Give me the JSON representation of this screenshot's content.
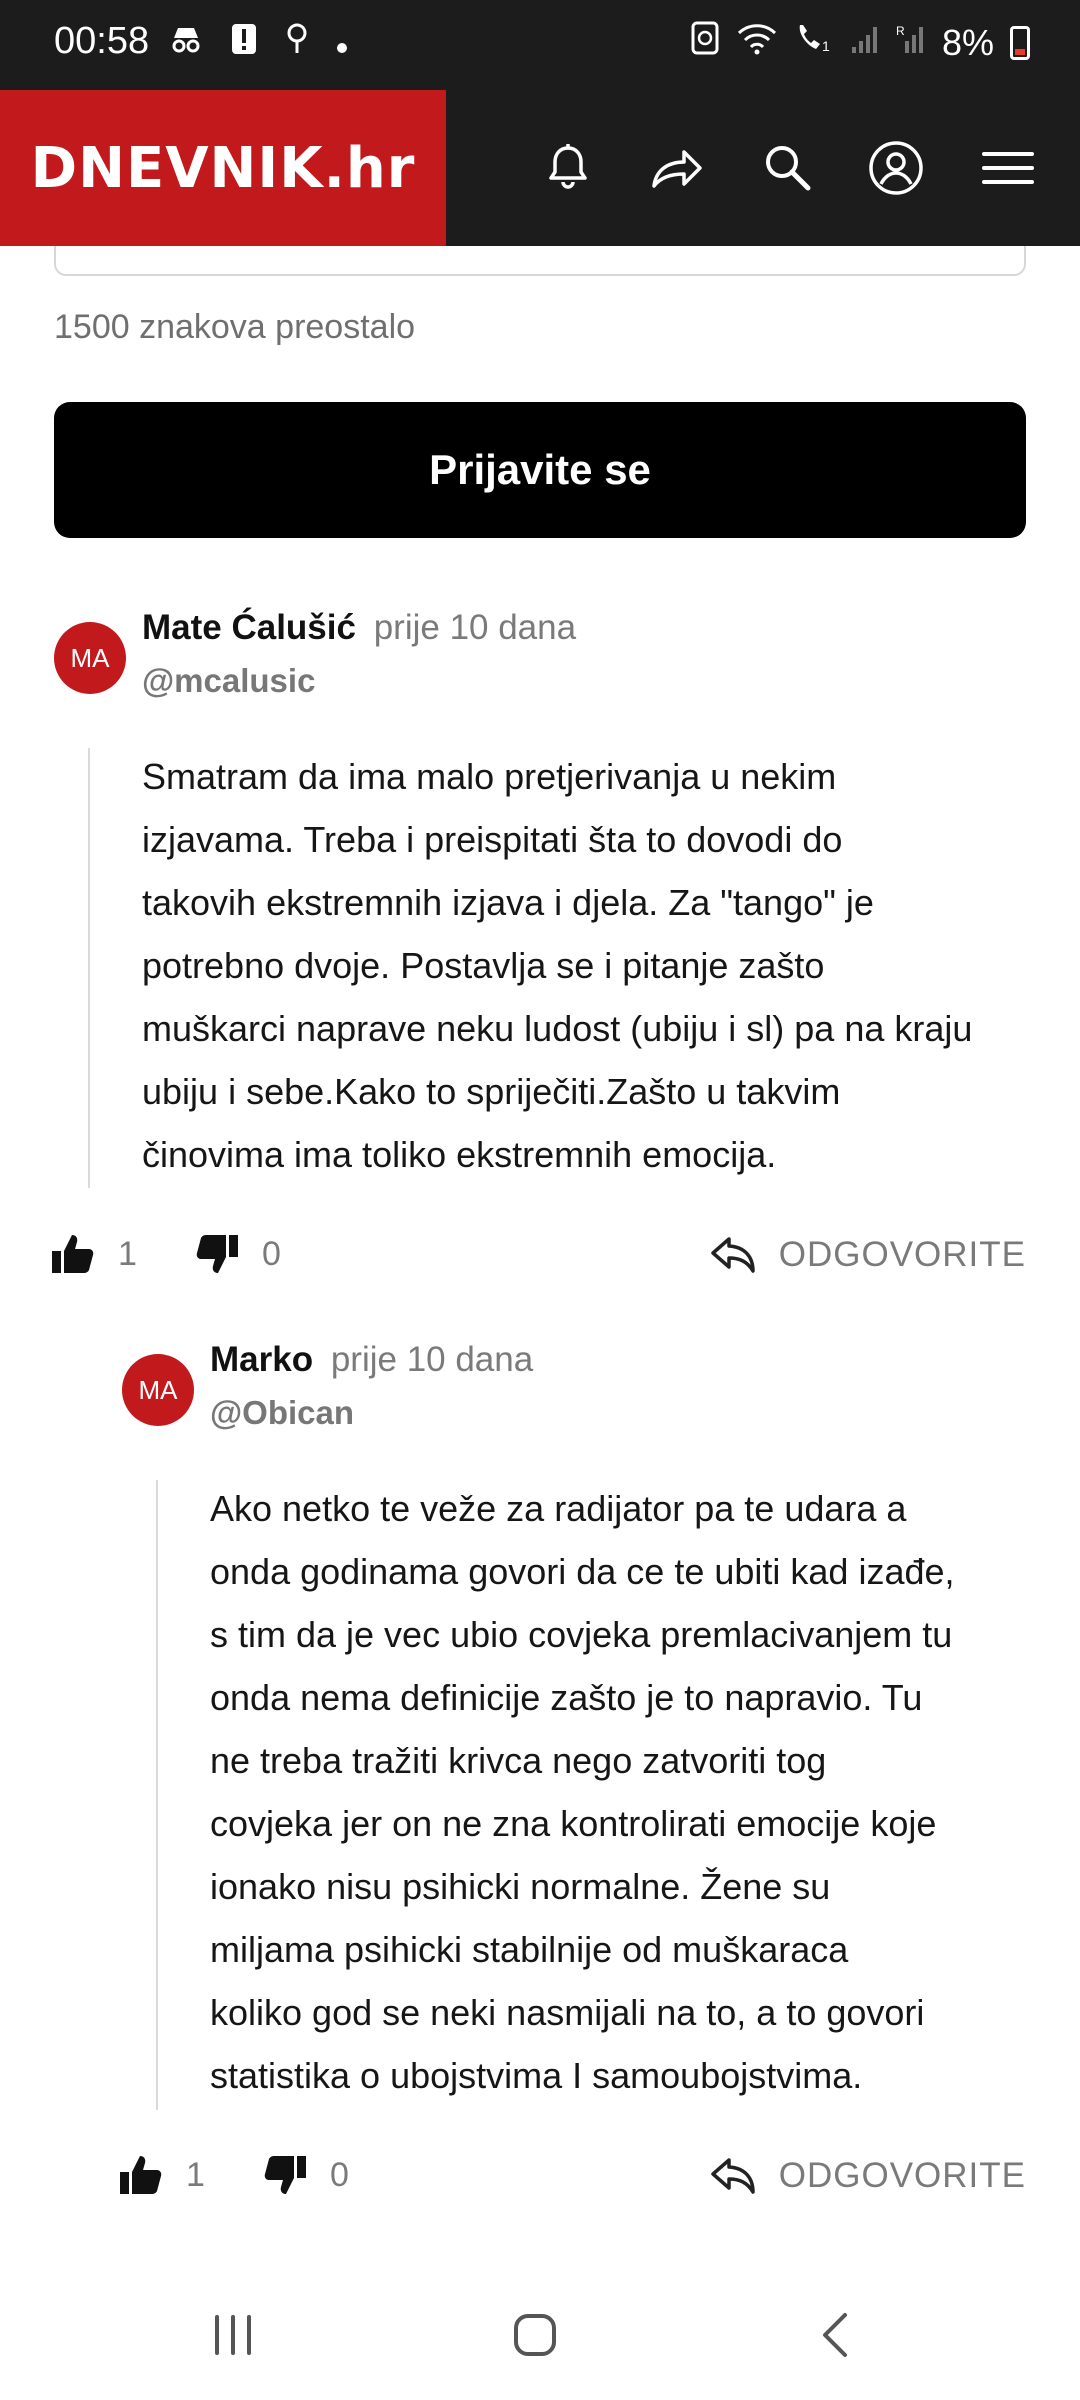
{
  "status_bar": {
    "time": "00:58",
    "battery_percent": "8%",
    "icons": [
      "incognito-icon",
      "alert-icon",
      "location-icon",
      "dot-icon",
      "recycle-icon",
      "wifi-icon",
      "wifi-call-icon",
      "signal-icon",
      "signal-roaming-icon",
      "battery-low-icon"
    ]
  },
  "header": {
    "logo": "DNEVNIK.hr",
    "brand_color": "#c2191c",
    "icons": [
      "bell-icon",
      "share-icon",
      "search-icon",
      "user-icon",
      "menu-icon"
    ]
  },
  "comment_form": {
    "chars_remaining": "1500 znakova preostalo",
    "login_label": "Prijavite se"
  },
  "comments": [
    {
      "initials": "MA",
      "name": "Mate Ćalušić",
      "time": "prije 10 dana",
      "handle": "@mcalusic",
      "lines": [
        "Smatram da ima malo pretjerivanja u nekim",
        "izjavama. Treba i preispitati šta to dovodi do",
        "takovih ekstremnih izjava i djela. Za \"tango\" je",
        "potrebno dvoje. Postavlja se i pitanje zašto",
        "muškarci naprave neku ludost (ubiju i sl) pa na kraju",
        "ubiju i sebe.Kako to spriječiti.Zašto u takvim",
        "činovima ima toliko ekstremnih emocija."
      ],
      "likes": "1",
      "dislikes": "0",
      "reply_label": "ODGOVORITE"
    },
    {
      "initials": "MA",
      "name": "Marko",
      "time": "prije 10 dana",
      "handle": "@Obican",
      "lines": [
        "Ako netko te veže za radijator pa te udara a",
        "onda godinama govori da ce te ubiti kad izađe,",
        "s tim da je vec ubio covjeka premlacivanjem tu",
        "onda nema definicije zašto je to napravio. Tu",
        "ne treba tražiti krivca nego zatvoriti tog",
        "covjeka jer on ne zna kontrolirati emocije koje",
        "ionako nisu psihicki normalne. Žene su",
        "miljama psihicki stabilnije od muškaraca",
        "koliko god se neki nasmijali na to, a to govori",
        "statistika o ubojstvima I samoubojstvima."
      ],
      "likes": "1",
      "dislikes": "0",
      "reply_label": "ODGOVORITE"
    }
  ],
  "nav_bar": {
    "icons": [
      "recents-icon",
      "home-icon",
      "back-icon"
    ]
  }
}
